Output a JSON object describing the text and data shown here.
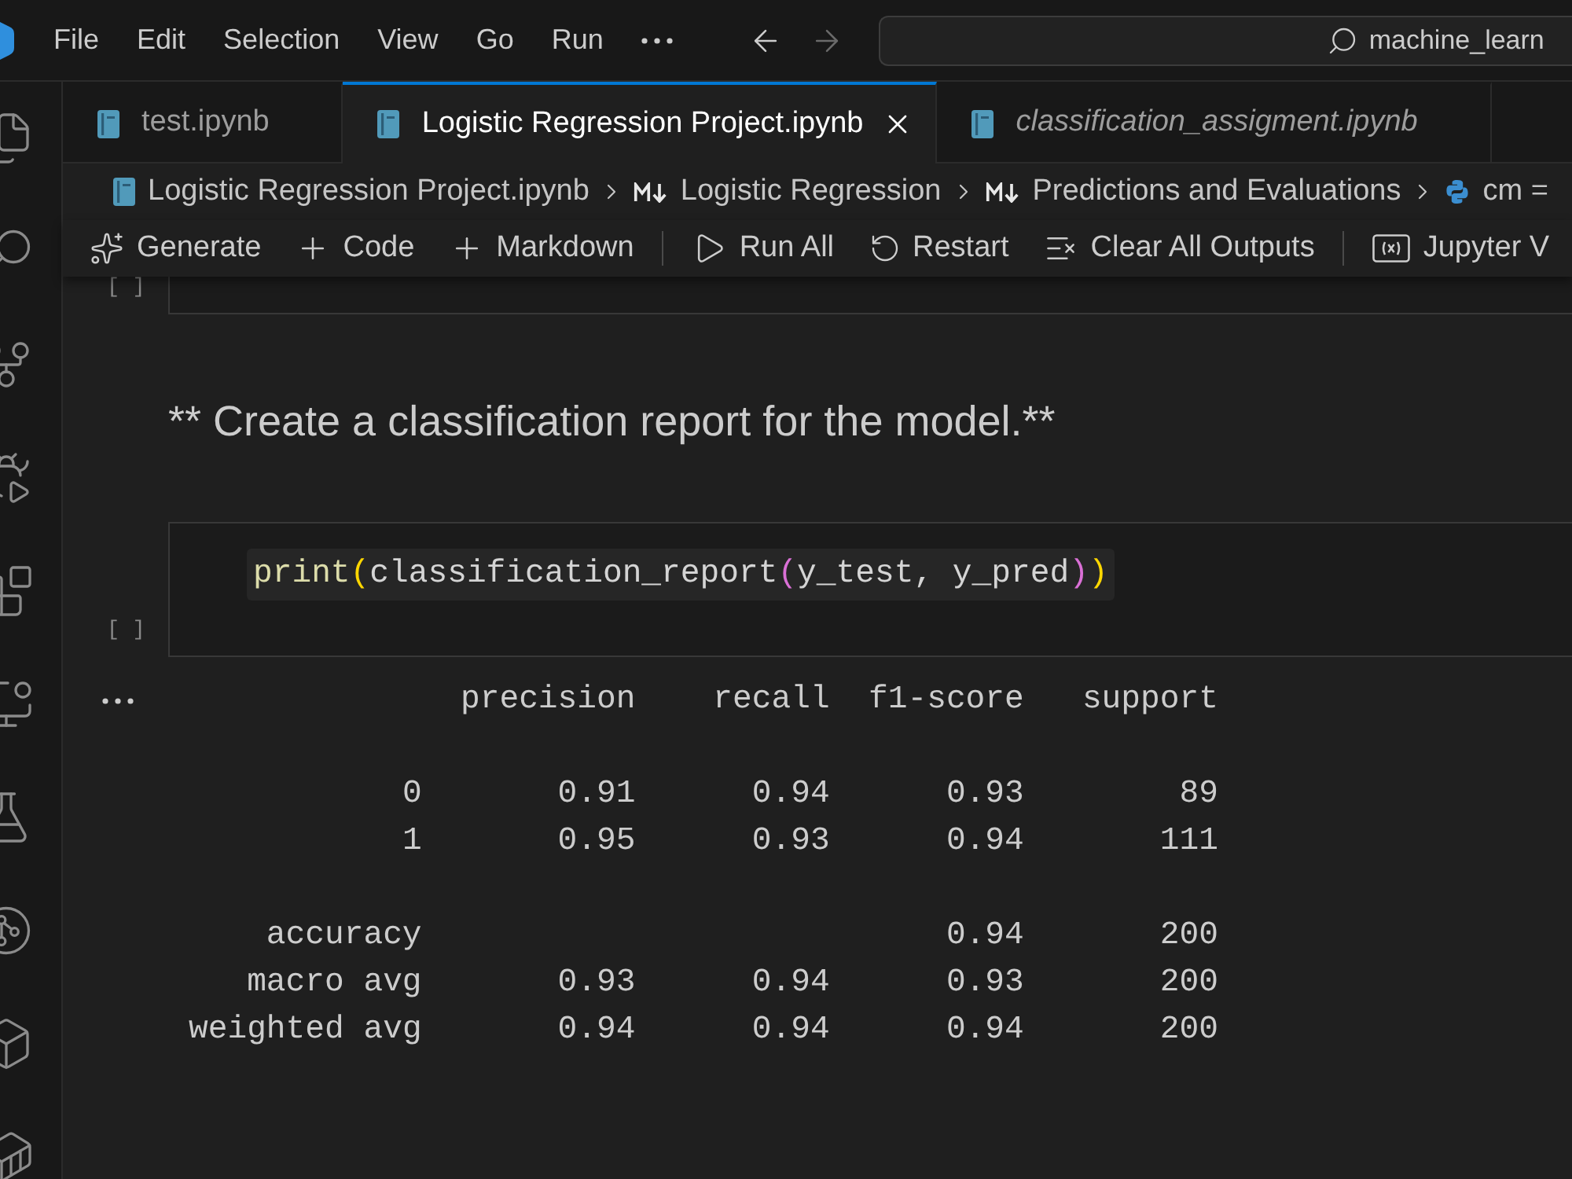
{
  "title_bar": {
    "menu": [
      "File",
      "Edit",
      "Selection",
      "View",
      "Go",
      "Run"
    ],
    "back_disabled": false,
    "forward_disabled": true,
    "command_center": {
      "label": "machine_learn"
    }
  },
  "tabs": [
    {
      "label": "test.ipynb",
      "selected": false,
      "preview": false
    },
    {
      "label": "Logistic Regression Project.ipynb",
      "selected": true,
      "preview": false
    },
    {
      "label": "classification_assigment.ipynb",
      "selected": false,
      "preview": true
    }
  ],
  "breadcrumb": [
    {
      "kind": "notebook",
      "label": "Logistic Regression Project.ipynb"
    },
    {
      "kind": "markdown",
      "label": "Logistic Regression"
    },
    {
      "kind": "markdown",
      "label": "Predictions and Evaluations"
    },
    {
      "kind": "python",
      "label": "cm ="
    }
  ],
  "toolbar": [
    [
      {
        "kind": "sparkle",
        "label": "Generate"
      },
      {
        "kind": "add",
        "label": "Code"
      },
      {
        "kind": "add",
        "label": "Markdown"
      }
    ],
    [
      {
        "kind": "run",
        "label": "Run All"
      },
      {
        "kind": "restart",
        "label": "Restart"
      },
      {
        "kind": "clear",
        "label": "Clear All Outputs"
      }
    ],
    [
      {
        "kind": "variables",
        "label": "Jupyter V"
      }
    ]
  ],
  "cells": [
    {
      "kind": "code",
      "execution_count": "[ ]"
    },
    {
      "kind": "markdown",
      "text": "** Create a classification report for the model.**"
    },
    {
      "kind": "code",
      "execution_count": "[ ]",
      "code": [
        {
          "text": "print",
          "kind": "function"
        },
        {
          "text": "(",
          "kind": "bracket_outer"
        },
        {
          "text": "classification_report",
          "kind": "plain"
        },
        {
          "text": "(",
          "kind": "bracket_inner"
        },
        {
          "text": "y_test, y_pred",
          "kind": "plain"
        },
        {
          "text": ")",
          "kind": "bracket_inner"
        },
        {
          "text": ")",
          "kind": "bracket_outer"
        }
      ],
      "output": {
        "columns": [
          "precision",
          "recall",
          "f1-score",
          "support"
        ],
        "class_rows": [
          {
            "label": "0",
            "precision": "0.91",
            "recall": "0.94",
            "f1_score": "0.93",
            "support": "89"
          },
          {
            "label": "1",
            "precision": "0.95",
            "recall": "0.93",
            "f1_score": "0.94",
            "support": "111"
          }
        ],
        "summary_rows": [
          {
            "label": "accuracy",
            "f1_score": "0.94",
            "support": "200"
          },
          {
            "label": "macro avg",
            "precision": "0.93",
            "recall": "0.94",
            "f1_score": "0.93",
            "support": "200"
          },
          {
            "label": "weighted avg",
            "precision": "0.94",
            "recall": "0.94",
            "f1_score": "0.94",
            "support": "200"
          }
        ]
      }
    }
  ]
}
